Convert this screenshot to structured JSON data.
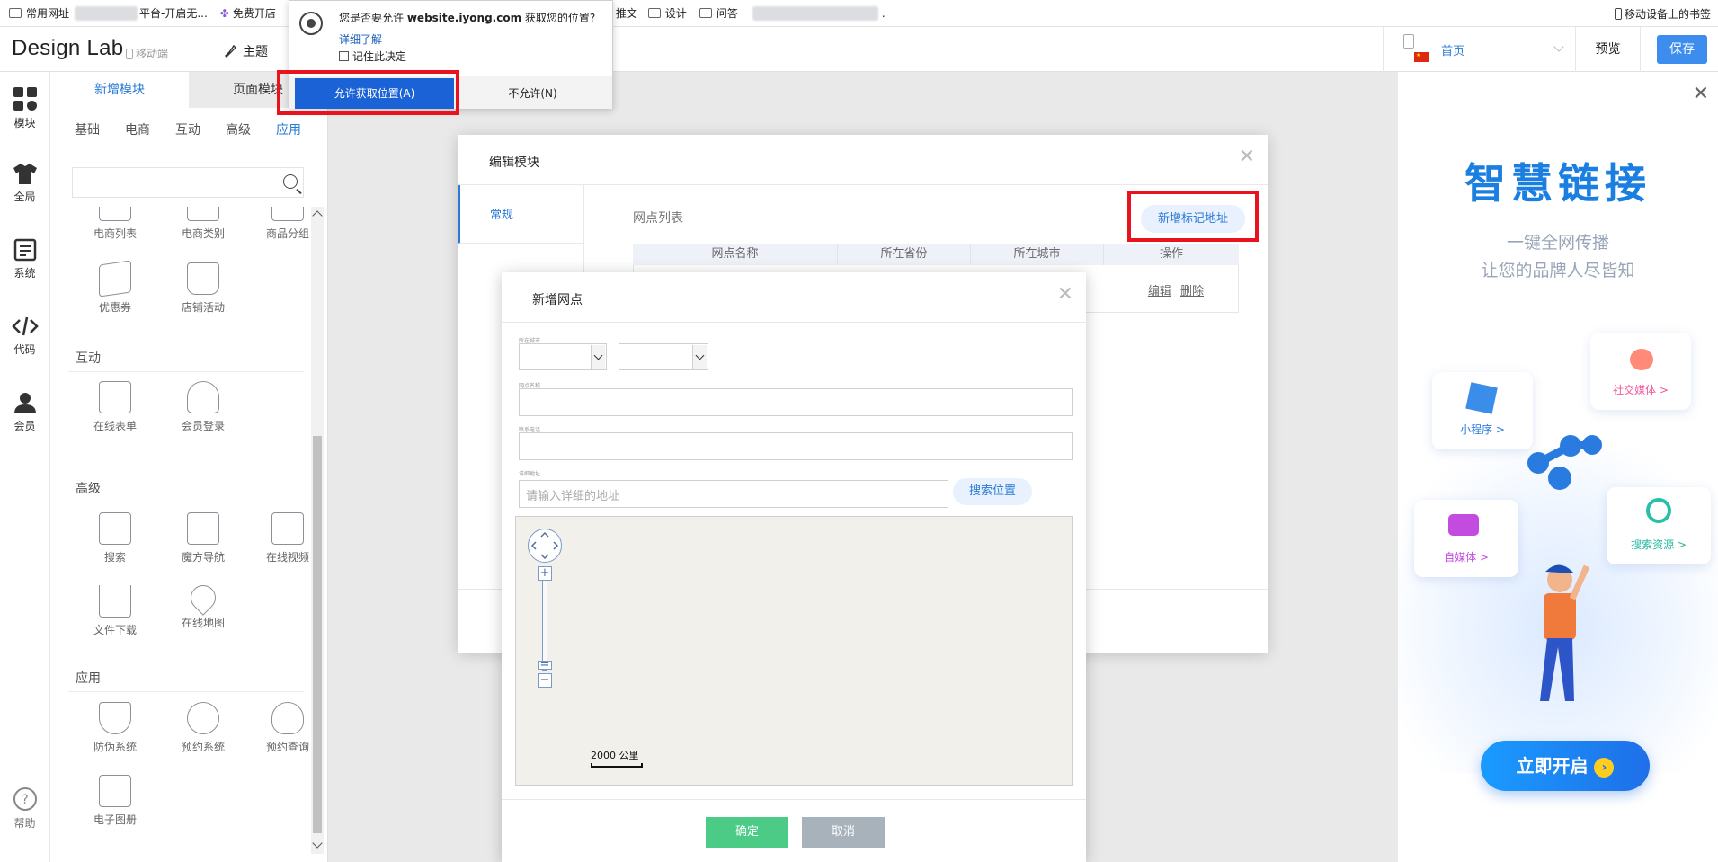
{
  "bookmarks": {
    "items": [
      "常用网址",
      "平台-开启无...",
      "免费开店",
      "推文",
      "设计",
      "问答",
      "."
    ],
    "right_label": "移动设备上的书签"
  },
  "topbar": {
    "logo": "Design Lab",
    "mobile_label": "移动端",
    "theme_label": "主题",
    "page_select": "首页",
    "preview_label": "预览",
    "save_label": "保存"
  },
  "rail": [
    {
      "label": "模块",
      "icon": "grid-icon"
    },
    {
      "label": "全局",
      "icon": "shirt-icon"
    },
    {
      "label": "系统",
      "icon": "document-icon"
    },
    {
      "label": "代码",
      "icon": "code-icon"
    },
    {
      "label": "会员",
      "icon": "user-icon"
    },
    {
      "label": "帮助",
      "icon": "help-icon"
    }
  ],
  "panel": {
    "tab_new": "新增模块",
    "tab_page": "页面模块",
    "subtabs": [
      "基础",
      "电商",
      "互动",
      "高级",
      "应用"
    ],
    "active_subtab": "应用",
    "modules_top": [
      "电商列表",
      "电商类别",
      "商品分组",
      "优惠券",
      "店铺活动"
    ],
    "section_interact": "互动",
    "modules_interact": [
      "在线表单",
      "会员登录"
    ],
    "section_advanced": "高级",
    "modules_advanced": [
      "搜索",
      "魔方导航",
      "在线视频",
      "文件下载",
      "在线地图"
    ],
    "section_app": "应用",
    "modules_app": [
      "防伪系统",
      "预约系统",
      "预约查询",
      "电子图册"
    ]
  },
  "edit_dialog": {
    "title": "编辑模块",
    "side_tab": "常规",
    "list_title": "网点列表",
    "add_button": "新增标记地址",
    "columns": [
      "网点名称",
      "所在省份",
      "所在城市",
      "操作"
    ],
    "row_ops": [
      "编辑",
      "删除"
    ]
  },
  "add_dialog": {
    "title": "新增网点",
    "label_region": "所在城市",
    "label_name": "网点名称",
    "label_phone": "联系电话",
    "label_address": "详细地址",
    "address_placeholder": "请输入详细的地址",
    "search_button": "搜索位置",
    "map_scale": "2000 公里",
    "ok_label": "确定",
    "cancel_label": "取消"
  },
  "geo_prompt": {
    "question_prefix": "您是否要允许",
    "site": "website.iyong.com",
    "question_suffix": "获取您的位置?",
    "learn_more": "详细了解",
    "remember": "记住此决定",
    "allow_label": "允许获取位置(A)",
    "deny_label": "不允许(N)"
  },
  "ad": {
    "title": "智慧链接",
    "subtitle_1": "一键全网传播",
    "subtitle_2": "让您的品牌人尽皆知",
    "cards": [
      "社交媒体 >",
      "小程序 >",
      "自媒体 >",
      "搜索资源 >"
    ],
    "cta": "立即开启"
  },
  "colors": {
    "accent": "#2a7bd6",
    "save": "#3c8dee",
    "ok": "#4ccb86",
    "cancel": "#a8b2bb",
    "highlight": "#e8131c"
  }
}
